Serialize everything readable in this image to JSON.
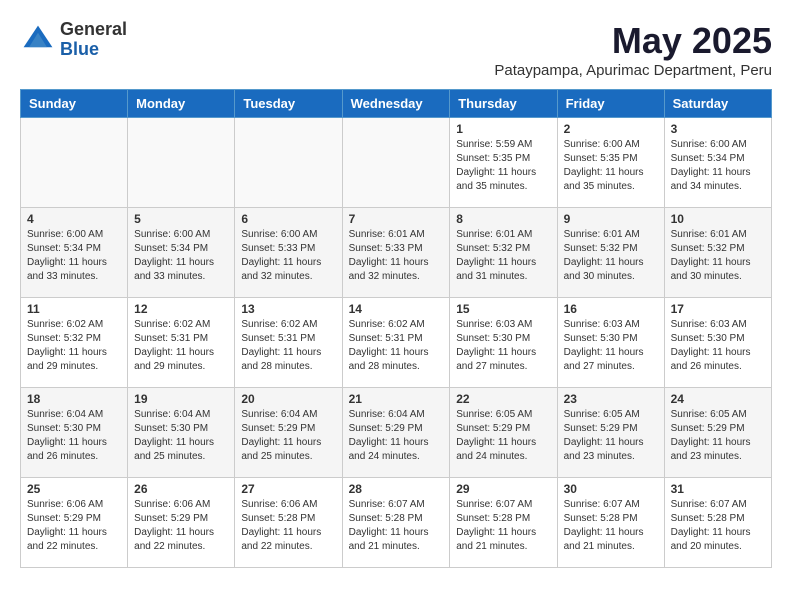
{
  "logo": {
    "general": "General",
    "blue": "Blue"
  },
  "title": {
    "month_year": "May 2025",
    "location": "Pataypampa, Apurimac Department, Peru"
  },
  "weekdays": [
    "Sunday",
    "Monday",
    "Tuesday",
    "Wednesday",
    "Thursday",
    "Friday",
    "Saturday"
  ],
  "weeks": [
    [
      {
        "day": "",
        "info": ""
      },
      {
        "day": "",
        "info": ""
      },
      {
        "day": "",
        "info": ""
      },
      {
        "day": "",
        "info": ""
      },
      {
        "day": "1",
        "info": "Sunrise: 5:59 AM\nSunset: 5:35 PM\nDaylight: 11 hours\nand 35 minutes."
      },
      {
        "day": "2",
        "info": "Sunrise: 6:00 AM\nSunset: 5:35 PM\nDaylight: 11 hours\nand 35 minutes."
      },
      {
        "day": "3",
        "info": "Sunrise: 6:00 AM\nSunset: 5:34 PM\nDaylight: 11 hours\nand 34 minutes."
      }
    ],
    [
      {
        "day": "4",
        "info": "Sunrise: 6:00 AM\nSunset: 5:34 PM\nDaylight: 11 hours\nand 33 minutes."
      },
      {
        "day": "5",
        "info": "Sunrise: 6:00 AM\nSunset: 5:34 PM\nDaylight: 11 hours\nand 33 minutes."
      },
      {
        "day": "6",
        "info": "Sunrise: 6:00 AM\nSunset: 5:33 PM\nDaylight: 11 hours\nand 32 minutes."
      },
      {
        "day": "7",
        "info": "Sunrise: 6:01 AM\nSunset: 5:33 PM\nDaylight: 11 hours\nand 32 minutes."
      },
      {
        "day": "8",
        "info": "Sunrise: 6:01 AM\nSunset: 5:32 PM\nDaylight: 11 hours\nand 31 minutes."
      },
      {
        "day": "9",
        "info": "Sunrise: 6:01 AM\nSunset: 5:32 PM\nDaylight: 11 hours\nand 30 minutes."
      },
      {
        "day": "10",
        "info": "Sunrise: 6:01 AM\nSunset: 5:32 PM\nDaylight: 11 hours\nand 30 minutes."
      }
    ],
    [
      {
        "day": "11",
        "info": "Sunrise: 6:02 AM\nSunset: 5:32 PM\nDaylight: 11 hours\nand 29 minutes."
      },
      {
        "day": "12",
        "info": "Sunrise: 6:02 AM\nSunset: 5:31 PM\nDaylight: 11 hours\nand 29 minutes."
      },
      {
        "day": "13",
        "info": "Sunrise: 6:02 AM\nSunset: 5:31 PM\nDaylight: 11 hours\nand 28 minutes."
      },
      {
        "day": "14",
        "info": "Sunrise: 6:02 AM\nSunset: 5:31 PM\nDaylight: 11 hours\nand 28 minutes."
      },
      {
        "day": "15",
        "info": "Sunrise: 6:03 AM\nSunset: 5:30 PM\nDaylight: 11 hours\nand 27 minutes."
      },
      {
        "day": "16",
        "info": "Sunrise: 6:03 AM\nSunset: 5:30 PM\nDaylight: 11 hours\nand 27 minutes."
      },
      {
        "day": "17",
        "info": "Sunrise: 6:03 AM\nSunset: 5:30 PM\nDaylight: 11 hours\nand 26 minutes."
      }
    ],
    [
      {
        "day": "18",
        "info": "Sunrise: 6:04 AM\nSunset: 5:30 PM\nDaylight: 11 hours\nand 26 minutes."
      },
      {
        "day": "19",
        "info": "Sunrise: 6:04 AM\nSunset: 5:30 PM\nDaylight: 11 hours\nand 25 minutes."
      },
      {
        "day": "20",
        "info": "Sunrise: 6:04 AM\nSunset: 5:29 PM\nDaylight: 11 hours\nand 25 minutes."
      },
      {
        "day": "21",
        "info": "Sunrise: 6:04 AM\nSunset: 5:29 PM\nDaylight: 11 hours\nand 24 minutes."
      },
      {
        "day": "22",
        "info": "Sunrise: 6:05 AM\nSunset: 5:29 PM\nDaylight: 11 hours\nand 24 minutes."
      },
      {
        "day": "23",
        "info": "Sunrise: 6:05 AM\nSunset: 5:29 PM\nDaylight: 11 hours\nand 23 minutes."
      },
      {
        "day": "24",
        "info": "Sunrise: 6:05 AM\nSunset: 5:29 PM\nDaylight: 11 hours\nand 23 minutes."
      }
    ],
    [
      {
        "day": "25",
        "info": "Sunrise: 6:06 AM\nSunset: 5:29 PM\nDaylight: 11 hours\nand 22 minutes."
      },
      {
        "day": "26",
        "info": "Sunrise: 6:06 AM\nSunset: 5:29 PM\nDaylight: 11 hours\nand 22 minutes."
      },
      {
        "day": "27",
        "info": "Sunrise: 6:06 AM\nSunset: 5:28 PM\nDaylight: 11 hours\nand 22 minutes."
      },
      {
        "day": "28",
        "info": "Sunrise: 6:07 AM\nSunset: 5:28 PM\nDaylight: 11 hours\nand 21 minutes."
      },
      {
        "day": "29",
        "info": "Sunrise: 6:07 AM\nSunset: 5:28 PM\nDaylight: 11 hours\nand 21 minutes."
      },
      {
        "day": "30",
        "info": "Sunrise: 6:07 AM\nSunset: 5:28 PM\nDaylight: 11 hours\nand 21 minutes."
      },
      {
        "day": "31",
        "info": "Sunrise: 6:07 AM\nSunset: 5:28 PM\nDaylight: 11 hours\nand 20 minutes."
      }
    ]
  ]
}
